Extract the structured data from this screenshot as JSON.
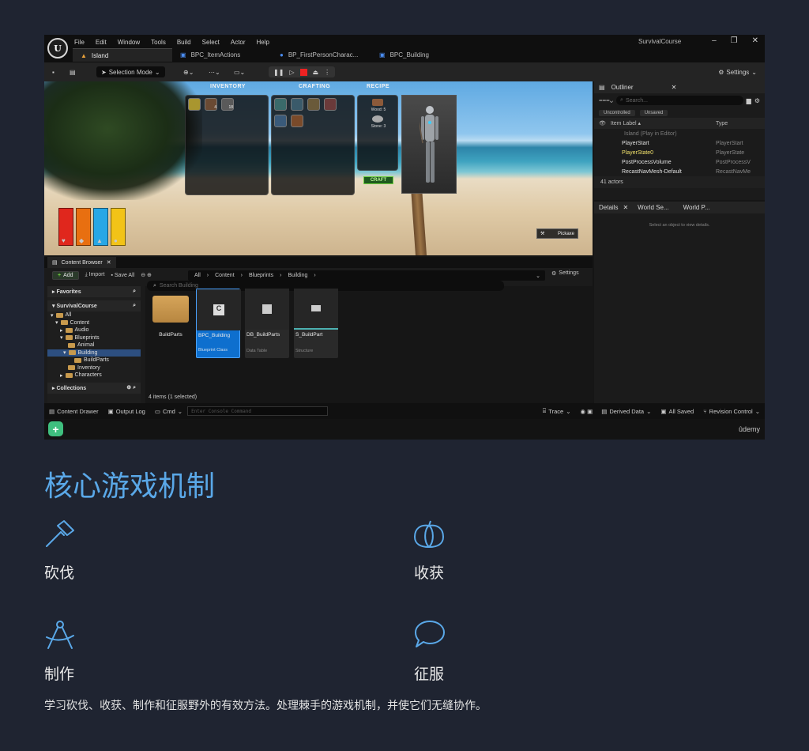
{
  "editor": {
    "menu": [
      "File",
      "Edit",
      "Window",
      "Tools",
      "Build",
      "Select",
      "Actor",
      "Help"
    ],
    "project_title": "SurvivalCourse",
    "tabs": [
      {
        "label": "Island",
        "active": true
      },
      {
        "label": "BPC_ItemActions",
        "active": false
      },
      {
        "label": "BP_FirstPersonCharac...",
        "active": false
      },
      {
        "label": "BPC_Building",
        "active": false
      }
    ],
    "toolbar": {
      "selection_mode": "Selection Mode",
      "settings": "Settings"
    },
    "viewport": {
      "inventory_title": "INVENTORY",
      "crafting_title": "CRAFTING",
      "recipe_title": "RECIPE",
      "inventory_counts": [
        "",
        "4",
        "18"
      ],
      "recipe_lines": [
        "Wood: 5",
        "Stone: 3"
      ],
      "craft_button": "CRAFT",
      "hotbar_item": "Pickaxe",
      "stat_colors": [
        "#e0271d",
        "#e86f10",
        "#8a8a8a",
        "#27a7e6",
        "#f2c317"
      ]
    },
    "outliner": {
      "title": "Outliner",
      "search_placeholder": "Search...",
      "chips": [
        "Uncontrolled",
        "Unsaved"
      ],
      "col_label": "Item Label ▴",
      "col_type": "Type",
      "rows": [
        {
          "label": "Island (Play in Editor)",
          "type": ""
        },
        {
          "label": "PlayerStart",
          "type": "PlayerStart"
        },
        {
          "label": "PlayerState0",
          "type": "PlayerState"
        },
        {
          "label": "PostProcessVolume",
          "type": "PostProcessV"
        },
        {
          "label": "RecastNavMesh-Default",
          "type": "RecastNavMe"
        }
      ],
      "count": "41 actors"
    },
    "details": {
      "tabs": [
        "Details",
        "World Se...",
        "World P..."
      ],
      "empty_hint": "Select an object to view details."
    },
    "content_browser": {
      "title": "Content Browser",
      "add": "Add",
      "import": "Import",
      "save_all": "Save All",
      "crumbs": [
        "All",
        "Content",
        "Blueprints",
        "Building"
      ],
      "settings": "Settings",
      "search_placeholder": "Search Building",
      "favorites": "Favorites",
      "project": "SurvivalCourse",
      "tree": [
        "All",
        "Content",
        "Audio",
        "Blueprints",
        "Animal",
        "Building",
        "BuildParts",
        "Inventory",
        "Characters"
      ],
      "collections": "Collections",
      "assets": [
        {
          "name": "BuildParts",
          "type": ""
        },
        {
          "name": "BPC_Building",
          "type": "Blueprint Class"
        },
        {
          "name": "DB_BuildParts",
          "type": "Data Table"
        },
        {
          "name": "S_BuildPart",
          "type": "Structure"
        }
      ],
      "item_count": "4 items (1 selected)"
    },
    "statusbar": {
      "content_drawer": "Content Drawer",
      "output_log": "Output Log",
      "cmd": "Cmd",
      "console_placeholder": "Enter Console Command",
      "trace": "Trace",
      "derived_data": "Derived Data",
      "all_saved": "All Saved",
      "revision_control": "Revision Control"
    },
    "watermark": "ûdemy"
  },
  "section": {
    "title": "核心游戏机制",
    "features": [
      {
        "label": "砍伐",
        "icon": "axe-icon"
      },
      {
        "label": "收获",
        "icon": "pumpkin-icon"
      },
      {
        "label": "制作",
        "icon": "compass-icon"
      },
      {
        "label": "征服",
        "icon": "speech-bubble-icon"
      }
    ],
    "description": "学习砍伐、收获、制作和征服野外的有效方法。处理棘手的游戏机制，并使它们无缝协作。",
    "accent_color": "#5aa8e8"
  }
}
